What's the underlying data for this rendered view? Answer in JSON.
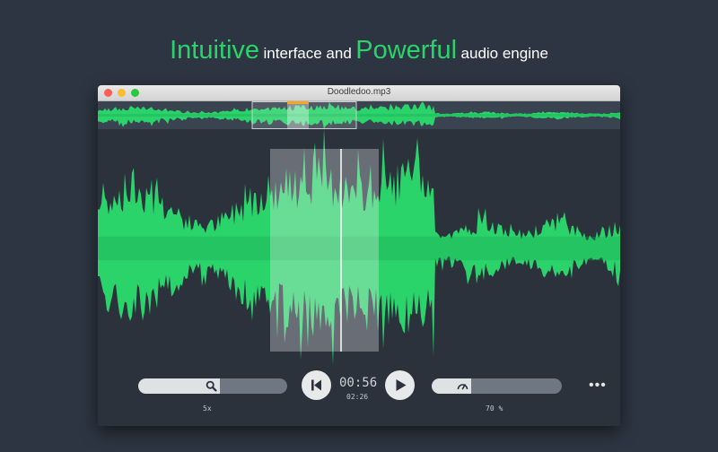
{
  "headline": {
    "word1": "Intuitive",
    "text1": "interface and",
    "word2": "Powerful",
    "text2": "audio engine"
  },
  "window": {
    "title": "Doodledoo.mp3"
  },
  "player": {
    "speed_label": "5x",
    "current_time": "00:56",
    "total_time": "02:26",
    "volume_label": "70 %",
    "more_label": "•••",
    "speed_value": 0.55,
    "volume_value": 0.3
  },
  "colors": {
    "accent": "#2bd36b",
    "background": "#2c3541",
    "window_bg": "#2b323c",
    "selection": "#e9eef0",
    "marker": "#f5a623"
  },
  "icons": {
    "speed_slider": "search-icon",
    "rewind": "skip-back-icon",
    "play": "play-icon",
    "volume_slider": "speedometer-icon",
    "more": "more-icon"
  }
}
